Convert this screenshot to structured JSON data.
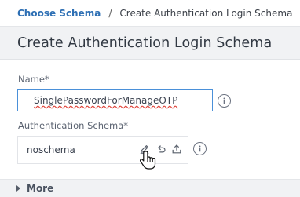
{
  "breadcrumb": {
    "parent": "Choose Schema",
    "separator": "/",
    "current": "Create Authentication Login Schema"
  },
  "page": {
    "title": "Create Authentication Login Schema"
  },
  "form": {
    "name_label": "Name*",
    "name_value": "SinglePasswordForManageOTP",
    "schema_label": "Authentication Schema*",
    "schema_value": "noschema"
  },
  "more": {
    "label": "More"
  },
  "icons": [
    "info-icon",
    "edit-icon",
    "undo-icon",
    "upload-icon",
    "hand-pointer-cursor",
    "caret-right-icon"
  ],
  "colors": {
    "link": "#2d6fb4",
    "input_focus_border": "#4a90d9",
    "spellcheck_underline": "#e0463d",
    "bar_background": "#f1f2f4"
  }
}
